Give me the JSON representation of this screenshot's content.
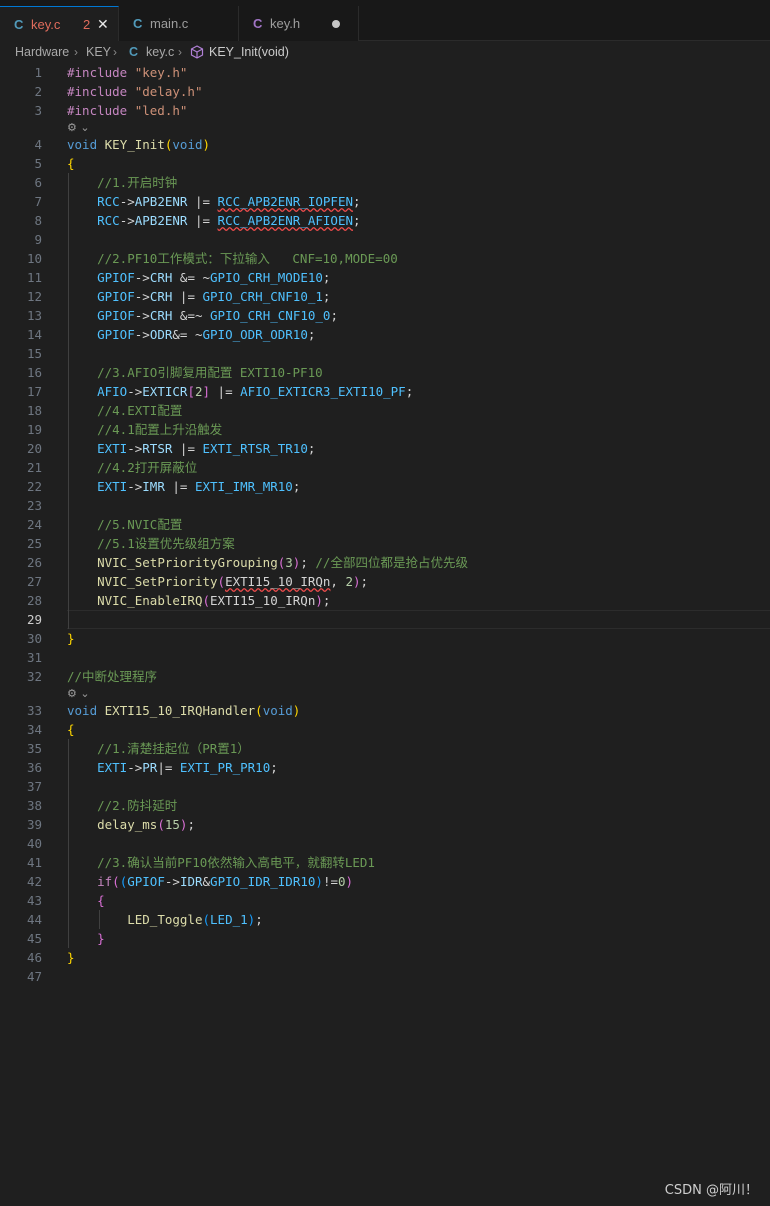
{
  "tabs": [
    {
      "icon": "C",
      "name": "key.c",
      "badge": "2",
      "close": "✕",
      "active": true
    },
    {
      "icon": "C",
      "name": "main.c",
      "active": false
    },
    {
      "icon": "C",
      "name": "key.h",
      "active": false,
      "modified": true
    }
  ],
  "breadcrumb": {
    "folder1": "Hardware",
    "folder2": "KEY",
    "file_icon": "C",
    "file": "key.c",
    "symbol": "KEY_Init(void)",
    "separator": "›"
  },
  "editor": {
    "current_line": 29,
    "code_lens_icon": "⚙︎ ⌄",
    "lines": [
      {
        "n": 1,
        "tokens": [
          [
            "pp",
            "#include "
          ],
          [
            "str",
            "\"key.h\""
          ]
        ]
      },
      {
        "n": 2,
        "tokens": [
          [
            "pp",
            "#include "
          ],
          [
            "str",
            "\"delay.h\""
          ]
        ]
      },
      {
        "n": 3,
        "tokens": [
          [
            "pp",
            "#include "
          ],
          [
            "str",
            "\"led.h\""
          ]
        ]
      },
      {
        "lens": true
      },
      {
        "n": 4,
        "tokens": [
          [
            "kw",
            "void "
          ],
          [
            "fn",
            "KEY_Init"
          ],
          [
            "b1",
            "("
          ],
          [
            "kw",
            "void"
          ],
          [
            "b1",
            ")"
          ]
        ]
      },
      {
        "n": 5,
        "tokens": [
          [
            "b1",
            "{"
          ]
        ]
      },
      {
        "n": 6,
        "tokens": [
          [
            "op",
            "    "
          ],
          [
            "com",
            "//1.开启时钟"
          ]
        ]
      },
      {
        "n": 7,
        "tokens": [
          [
            "op",
            "    "
          ],
          [
            "mac",
            "RCC"
          ],
          [
            "op",
            "->"
          ],
          [
            "var",
            "APB2ENR"
          ],
          [
            "op",
            " |= "
          ],
          [
            "mac",
            "RCC_APB2ENR_IOPFEN",
            "err"
          ],
          [
            "op",
            ";"
          ]
        ]
      },
      {
        "n": 8,
        "tokens": [
          [
            "op",
            "    "
          ],
          [
            "mac",
            "RCC"
          ],
          [
            "op",
            "->"
          ],
          [
            "var",
            "APB2ENR"
          ],
          [
            "op",
            " |= "
          ],
          [
            "mac",
            "RCC_APB2ENR_AFIOEN",
            "err"
          ],
          [
            "op",
            ";"
          ]
        ]
      },
      {
        "n": 9,
        "tokens": []
      },
      {
        "n": 10,
        "tokens": [
          [
            "op",
            "    "
          ],
          [
            "com",
            "//2.PF10工作模式：下拉输入   CNF=10,MODE=00"
          ]
        ]
      },
      {
        "n": 11,
        "tokens": [
          [
            "op",
            "    "
          ],
          [
            "mac",
            "GPIOF"
          ],
          [
            "op",
            "->"
          ],
          [
            "var",
            "CRH"
          ],
          [
            "op",
            " &= ~"
          ],
          [
            "mac",
            "GPIO_CRH_MODE10"
          ],
          [
            "op",
            ";"
          ]
        ]
      },
      {
        "n": 12,
        "tokens": [
          [
            "op",
            "    "
          ],
          [
            "mac",
            "GPIOF"
          ],
          [
            "op",
            "->"
          ],
          [
            "var",
            "CRH"
          ],
          [
            "op",
            " |= "
          ],
          [
            "mac",
            "GPIO_CRH_CNF10_1"
          ],
          [
            "op",
            ";"
          ]
        ]
      },
      {
        "n": 13,
        "tokens": [
          [
            "op",
            "    "
          ],
          [
            "mac",
            "GPIOF"
          ],
          [
            "op",
            "->"
          ],
          [
            "var",
            "CRH"
          ],
          [
            "op",
            " &=~ "
          ],
          [
            "mac",
            "GPIO_CRH_CNF10_0"
          ],
          [
            "op",
            ";"
          ]
        ]
      },
      {
        "n": 14,
        "tokens": [
          [
            "op",
            "    "
          ],
          [
            "mac",
            "GPIOF"
          ],
          [
            "op",
            "->"
          ],
          [
            "var",
            "ODR"
          ],
          [
            "op",
            "&= ~"
          ],
          [
            "mac",
            "GPIO_ODR_ODR10"
          ],
          [
            "op",
            ";"
          ]
        ]
      },
      {
        "n": 15,
        "tokens": []
      },
      {
        "n": 16,
        "tokens": [
          [
            "op",
            "    "
          ],
          [
            "com",
            "//3.AFIO引脚复用配置 EXTI10-PF10"
          ]
        ]
      },
      {
        "n": 17,
        "tokens": [
          [
            "op",
            "    "
          ],
          [
            "mac",
            "AFIO"
          ],
          [
            "op",
            "->"
          ],
          [
            "var",
            "EXTICR"
          ],
          [
            "b2",
            "["
          ],
          [
            "num",
            "2"
          ],
          [
            "b2",
            "]"
          ],
          [
            "op",
            " |= "
          ],
          [
            "mac",
            "AFIO_EXTICR3_EXTI10_PF"
          ],
          [
            "op",
            ";"
          ]
        ]
      },
      {
        "n": 18,
        "tokens": [
          [
            "op",
            "    "
          ],
          [
            "com",
            "//4.EXTI配置"
          ]
        ]
      },
      {
        "n": 19,
        "tokens": [
          [
            "op",
            "    "
          ],
          [
            "com",
            "//4.1配置上升沿触发"
          ]
        ]
      },
      {
        "n": 20,
        "tokens": [
          [
            "op",
            "    "
          ],
          [
            "mac",
            "EXTI"
          ],
          [
            "op",
            "->"
          ],
          [
            "var",
            "RTSR"
          ],
          [
            "op",
            " |= "
          ],
          [
            "mac",
            "EXTI_RTSR_TR10"
          ],
          [
            "op",
            ";"
          ]
        ]
      },
      {
        "n": 21,
        "tokens": [
          [
            "op",
            "    "
          ],
          [
            "com",
            "//4.2打开屏蔽位"
          ]
        ]
      },
      {
        "n": 22,
        "tokens": [
          [
            "op",
            "    "
          ],
          [
            "mac",
            "EXTI"
          ],
          [
            "op",
            "->"
          ],
          [
            "var",
            "IMR"
          ],
          [
            "op",
            " |= "
          ],
          [
            "mac",
            "EXTI_IMR_MR10"
          ],
          [
            "op",
            ";"
          ]
        ]
      },
      {
        "n": 23,
        "tokens": []
      },
      {
        "n": 24,
        "tokens": [
          [
            "op",
            "    "
          ],
          [
            "com",
            "//5.NVIC配置"
          ]
        ]
      },
      {
        "n": 25,
        "tokens": [
          [
            "op",
            "    "
          ],
          [
            "com",
            "//5.1设置优先级组方案"
          ]
        ]
      },
      {
        "n": 26,
        "tokens": [
          [
            "op",
            "    "
          ],
          [
            "fn",
            "NVIC_SetPriorityGrouping"
          ],
          [
            "b2",
            "("
          ],
          [
            "num",
            "3"
          ],
          [
            "b2",
            ")"
          ],
          [
            "op",
            "; "
          ],
          [
            "com",
            "//全部四位都是抢占优先级"
          ]
        ]
      },
      {
        "n": 27,
        "tokens": [
          [
            "op",
            "    "
          ],
          [
            "fn",
            "NVIC_SetPriority"
          ],
          [
            "b2",
            "("
          ],
          [
            "op",
            "EXTI15_10_IRQn",
            "err"
          ],
          [
            "op",
            ", "
          ],
          [
            "num",
            "2"
          ],
          [
            "b2",
            ")"
          ],
          [
            "op",
            ";"
          ]
        ]
      },
      {
        "n": 28,
        "tokens": [
          [
            "op",
            "    "
          ],
          [
            "fn",
            "NVIC_EnableIRQ"
          ],
          [
            "b2",
            "("
          ],
          [
            "op",
            "EXTI15_10_IRQn"
          ],
          [
            "b2",
            ")"
          ],
          [
            "op",
            ";"
          ]
        ]
      },
      {
        "n": 29,
        "tokens": []
      },
      {
        "n": 30,
        "tokens": [
          [
            "b1",
            "}"
          ]
        ]
      },
      {
        "n": 31,
        "tokens": []
      },
      {
        "n": 32,
        "tokens": [
          [
            "com",
            "//中断处理程序"
          ]
        ]
      },
      {
        "lens": true
      },
      {
        "n": 33,
        "tokens": [
          [
            "kw",
            "void "
          ],
          [
            "fn",
            "EXTI15_10_IRQHandler"
          ],
          [
            "b1",
            "("
          ],
          [
            "kw",
            "void"
          ],
          [
            "b1",
            ")"
          ]
        ]
      },
      {
        "n": 34,
        "tokens": [
          [
            "b1",
            "{"
          ]
        ]
      },
      {
        "n": 35,
        "tokens": [
          [
            "op",
            "    "
          ],
          [
            "com",
            "//1.清楚挂起位（PR置1）"
          ]
        ]
      },
      {
        "n": 36,
        "tokens": [
          [
            "op",
            "    "
          ],
          [
            "mac",
            "EXTI"
          ],
          [
            "op",
            "->"
          ],
          [
            "var",
            "PR"
          ],
          [
            "op",
            "|= "
          ],
          [
            "mac",
            "EXTI_PR_PR10"
          ],
          [
            "op",
            ";"
          ]
        ]
      },
      {
        "n": 37,
        "tokens": []
      },
      {
        "n": 38,
        "tokens": [
          [
            "op",
            "    "
          ],
          [
            "com",
            "//2.防抖延时"
          ]
        ]
      },
      {
        "n": 39,
        "tokens": [
          [
            "op",
            "    "
          ],
          [
            "fn",
            "delay_ms"
          ],
          [
            "b2",
            "("
          ],
          [
            "num",
            "15"
          ],
          [
            "b2",
            ")"
          ],
          [
            "op",
            ";"
          ]
        ]
      },
      {
        "n": 40,
        "tokens": []
      },
      {
        "n": 41,
        "tokens": [
          [
            "op",
            "    "
          ],
          [
            "com",
            "//3.确认当前PF10依然输入高电平，就翻转LED1"
          ]
        ]
      },
      {
        "n": 42,
        "tokens": [
          [
            "op",
            "    "
          ],
          [
            "pp",
            "if"
          ],
          [
            "b2",
            "("
          ],
          [
            "b3",
            "("
          ],
          [
            "mac",
            "GPIOF"
          ],
          [
            "op",
            "->"
          ],
          [
            "var",
            "IDR"
          ],
          [
            "op",
            "&"
          ],
          [
            "mac",
            "GPIO_IDR_IDR10"
          ],
          [
            "b3",
            ")"
          ],
          [
            "op",
            "!="
          ],
          [
            "num",
            "0"
          ],
          [
            "b2",
            ")"
          ]
        ]
      },
      {
        "n": 43,
        "tokens": [
          [
            "op",
            "    "
          ],
          [
            "b2",
            "{"
          ]
        ]
      },
      {
        "n": 44,
        "tokens": [
          [
            "op",
            "        "
          ],
          [
            "fn",
            "LED_Toggle"
          ],
          [
            "b3",
            "("
          ],
          [
            "mac",
            "LED_1"
          ],
          [
            "b3",
            ")"
          ],
          [
            "op",
            ";"
          ]
        ]
      },
      {
        "n": 45,
        "tokens": [
          [
            "op",
            "    "
          ],
          [
            "b2",
            "}"
          ]
        ]
      },
      {
        "n": 46,
        "tokens": [
          [
            "b1",
            "}"
          ]
        ]
      },
      {
        "n": 47,
        "tokens": []
      }
    ]
  },
  "watermark": "CSDN @阿川！"
}
